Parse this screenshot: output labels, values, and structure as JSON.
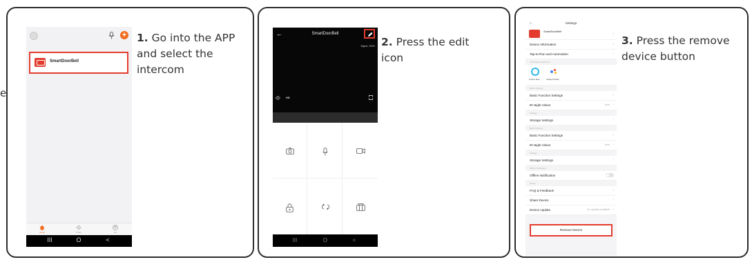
{
  "edge_fragment": "e",
  "steps": [
    {
      "number": "1.",
      "text": "Go into the APP and select the intercom",
      "phone": {
        "device_name": "SmartDoorBell",
        "tabs": [
          "Home",
          "Smart",
          "Me"
        ],
        "nav": [
          "III",
          "O",
          "<"
        ]
      }
    },
    {
      "number": "2.",
      "text": "Press the edit icon",
      "phone": {
        "title": "SmartDoorBell",
        "signal": "Signal: 100%",
        "quality": "HD",
        "nav": [
          "III",
          "O",
          "<"
        ]
      }
    },
    {
      "number": "3.",
      "text": "Press the remove device button",
      "phone": {
        "title": "Settings",
        "device_name": "SmartDoorBell",
        "rows": {
          "device_information": "Device Information",
          "tap_to_run": "Tap-to-Run and Automation",
          "third_party": "Third-Party Supported",
          "alexa": "amazon alexa",
          "google": "Google Assistant",
          "basic_settings_1": "Basic Settings",
          "basic_function_1": "Basic Function Settings",
          "ir_night_1": "IR Night Vision",
          "ir_night_val_1": "Auto",
          "storage_1": "Storage",
          "storage_settings_1": "Storage Settings",
          "basic_settings_2": "Basic Settings",
          "basic_function_2": "Basic Function Settings",
          "ir_night_2": "IR Night Vision",
          "ir_night_val_2": "Auto",
          "storage_2": "Storage",
          "storage_settings_2": "Storage Settings",
          "offline_section": "Offline Notification",
          "offline_notification": "Offline Notification",
          "others": "Others",
          "faq": "FAQ & Feedback",
          "share": "Share Device",
          "update": "Device Update",
          "update_val": "No updates available",
          "remove": "Remove Device"
        }
      }
    }
  ],
  "colors": {
    "highlight": "#e33b2e",
    "accent": "#f26b1d"
  }
}
